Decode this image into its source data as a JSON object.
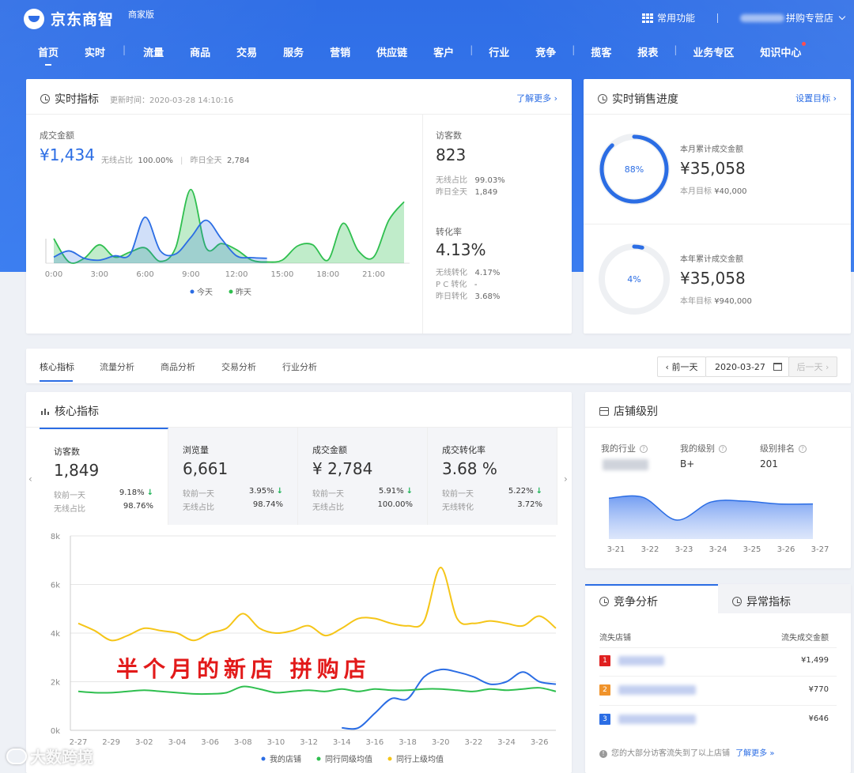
{
  "app": {
    "logo_text": "京东商智",
    "edition": "商家版"
  },
  "top_right": {
    "common_functions": "常用功能",
    "store_name": "拼购专营店"
  },
  "nav": [
    "首页",
    "实时",
    "流量",
    "商品",
    "交易",
    "服务",
    "营销",
    "供应链",
    "客户",
    "行业",
    "竞争",
    "揽客",
    "报表",
    "业务专区",
    "知识中心"
  ],
  "realtime": {
    "title": "实时指标",
    "update_label": "更新时间：2020-03-28 14:10:16",
    "learn_more": "了解更多 ›",
    "gmv": {
      "label": "成交金额",
      "value": "¥1,434",
      "wireless_label": "无线占比",
      "wireless_value": "100.00%",
      "yesterday_label": "昨日全天",
      "yesterday_value": "2,784"
    },
    "visitors": {
      "label": "访客数",
      "value": "823",
      "wireless_label": "无线占比",
      "wireless_value": "99.03%",
      "yesterday_label": "昨日全天",
      "yesterday_value": "1,849"
    },
    "conversion": {
      "label": "转化率",
      "value": "4.13%",
      "wireless_label": "无线转化",
      "wireless_value": "4.17%",
      "pc_label": "P C 转化",
      "pc_value": "-",
      "yesterday_label": "昨日转化",
      "yesterday_value": "3.68%"
    },
    "legend": {
      "today": "今天",
      "yesterday": "昨天"
    }
  },
  "sales_progress": {
    "title": "实时销售进度",
    "set_target": "设置目标 ›",
    "month": {
      "label": "本月累计成交金额",
      "value": "¥35,058",
      "target_label": "本月目标",
      "target_value": "¥40,000",
      "percent_text": "88%",
      "percent": 88
    },
    "year": {
      "label": "本年累计成交金额",
      "value": "¥35,058",
      "target_label": "本年目标",
      "target_value": "¥940,000",
      "percent_text": "4%",
      "percent": 4
    }
  },
  "tabs": [
    "核心指标",
    "流量分析",
    "商品分析",
    "交易分析",
    "行业分析"
  ],
  "date_nav": {
    "prev": "‹ 前一天",
    "date": "2020-03-27",
    "next": "后一天 ›"
  },
  "core": {
    "title": "核心指标",
    "metrics": [
      {
        "name": "访客数",
        "value": "1,849",
        "r1_label": "较前一天",
        "r1_value": "9.18%",
        "r2_label": "无线占比",
        "r2_value": "98.76%"
      },
      {
        "name": "浏览量",
        "value": "6,661",
        "r1_label": "较前一天",
        "r1_value": "3.95%",
        "r2_label": "无线占比",
        "r2_value": "98.74%"
      },
      {
        "name": "成交金额",
        "value": "¥ 2,784",
        "r1_label": "较前一天",
        "r1_value": "5.91%",
        "r2_label": "无线占比",
        "r2_value": "100.00%"
      },
      {
        "name": "成交转化率",
        "value": "3.68 %",
        "r1_label": "较前一天",
        "r1_value": "5.22%",
        "r2_label": "无线转化",
        "r2_value": "3.72%"
      }
    ],
    "down_arrow": "↓",
    "overlay_text": "半个月的新店 拼购店"
  },
  "store_level": {
    "title": "店铺级别",
    "industry_label": "我的行业",
    "level_label": "我的级别",
    "level_value": "B+",
    "rank_label": "级别排名",
    "rank_value": "201"
  },
  "competition": {
    "tab_active": "竞争分析",
    "tab_inactive": "异常指标",
    "col_left": "流失店铺",
    "col_right": "流失成交金额",
    "rows": [
      {
        "rank": "1",
        "amount": "¥1,499",
        "color": "#e02020"
      },
      {
        "rank": "2",
        "amount": "¥770",
        "color": "#f0932b"
      },
      {
        "rank": "3",
        "amount": "¥646",
        "color": "#2b6de4"
      }
    ],
    "footer": "您的大部分访客流失到了以上店铺",
    "footer_link": "了解更多 »"
  },
  "watermark": "大数跨境",
  "colors": {
    "brand": "#2f6ee6",
    "accent": "#2b6de4",
    "green": "#2fbf4f",
    "yellow": "#f5c518",
    "red_text": "#e21a1a"
  },
  "chart_data": [
    {
      "type": "area",
      "xlabels": [
        "0:00",
        "3:00",
        "6:00",
        "9:00",
        "12:00",
        "15:00",
        "18:00",
        "21:00"
      ],
      "x_range": [
        0,
        23
      ],
      "series": [
        {
          "name": "今天",
          "color": "#2b6de4",
          "x": [
            0,
            1,
            2,
            3,
            4,
            5,
            6,
            7,
            8,
            9,
            10,
            11,
            12,
            13,
            14
          ],
          "values": [
            10,
            20,
            8,
            5,
            12,
            14,
            75,
            20,
            15,
            42,
            70,
            40,
            12,
            9,
            8
          ]
        },
        {
          "name": "昨天",
          "color": "#2fbf4f",
          "x": [
            0,
            1,
            2,
            3,
            4,
            5,
            6,
            7,
            8,
            9,
            10,
            11,
            12,
            13,
            14,
            15,
            16,
            17,
            18,
            19,
            20,
            21,
            22,
            23
          ],
          "values": [
            40,
            2,
            8,
            30,
            10,
            18,
            25,
            3,
            25,
            120,
            25,
            32,
            22,
            5,
            2,
            5,
            28,
            30,
            5,
            65,
            20,
            10,
            70,
            100
          ]
        }
      ]
    },
    {
      "type": "line",
      "categories": [
        "2-27",
        "2-28",
        "2-29",
        "3-01",
        "3-02",
        "3-03",
        "3-04",
        "3-05",
        "3-06",
        "3-07",
        "3-08",
        "3-09",
        "3-10",
        "3-11",
        "3-12",
        "3-13",
        "3-14",
        "3-15",
        "3-16",
        "3-17",
        "3-18",
        "3-19",
        "3-20",
        "3-21",
        "3-22",
        "3-23",
        "3-24",
        "3-25",
        "3-26",
        "3-27"
      ],
      "tick_labels": [
        "2-27",
        "2-29",
        "3-02",
        "3-04",
        "3-06",
        "3-08",
        "3-10",
        "3-12",
        "3-14",
        "3-16",
        "3-18",
        "3-20",
        "3-22",
        "3-24",
        "3-26"
      ],
      "yticks": [
        "0k",
        "2k",
        "4k",
        "6k",
        "8k"
      ],
      "ylim": [
        0,
        8000
      ],
      "series": [
        {
          "name": "我的店铺",
          "color": "#2b6de4",
          "start": 16,
          "values": [
            null,
            null,
            null,
            null,
            null,
            null,
            null,
            null,
            null,
            null,
            null,
            null,
            null,
            null,
            null,
            null,
            100,
            100,
            700,
            1300,
            1300,
            2200,
            2500,
            2400,
            2200,
            1900,
            2000,
            2400,
            2000,
            1900
          ]
        },
        {
          "name": "同行同级均值",
          "color": "#2fbf4f",
          "values": [
            1600,
            1550,
            1550,
            1600,
            1650,
            1600,
            1550,
            1500,
            1500,
            1550,
            1800,
            1700,
            1550,
            1600,
            1650,
            1600,
            1700,
            1600,
            1700,
            1650,
            1650,
            1700,
            1700,
            1650,
            1600,
            1700,
            1650,
            1700,
            1750,
            1600
          ]
        },
        {
          "name": "同行上级均值",
          "color": "#f5c518",
          "values": [
            4400,
            4100,
            3700,
            3900,
            4200,
            4100,
            4000,
            3700,
            4000,
            4200,
            4800,
            4200,
            4000,
            4100,
            4300,
            3900,
            4200,
            4600,
            4600,
            4400,
            4300,
            4500,
            6700,
            4600,
            4400,
            4500,
            4400,
            4300,
            4700,
            4200
          ]
        }
      ]
    },
    {
      "type": "area",
      "categories": [
        "3-21",
        "3-22",
        "3-23",
        "3-24",
        "3-25",
        "3-26",
        "3-27"
      ],
      "values": [
        86,
        88,
        40,
        78,
        80,
        74,
        74
      ],
      "color": "#2b6de4"
    }
  ]
}
